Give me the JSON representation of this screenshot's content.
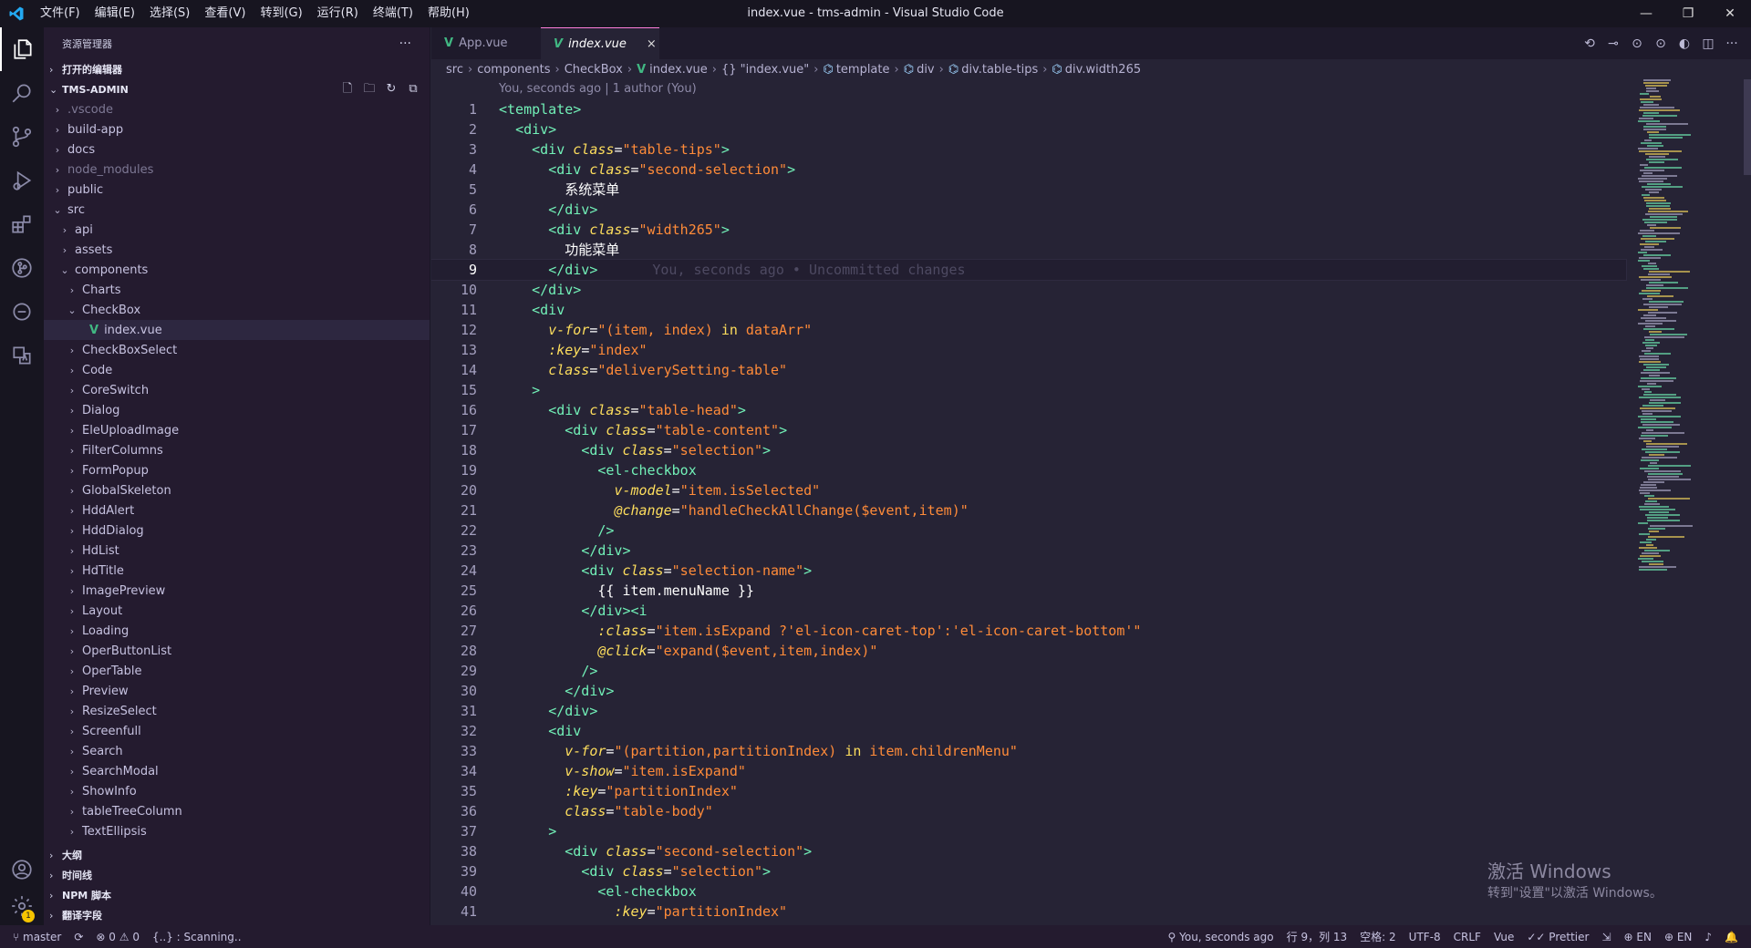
{
  "menu": [
    "文件(F)",
    "编辑(E)",
    "选择(S)",
    "查看(V)",
    "转到(G)",
    "运行(R)",
    "终端(T)",
    "帮助(H)"
  ],
  "window_title": "index.vue - tms-admin - Visual Studio Code",
  "sidebar": {
    "title": "资源管理器",
    "more": "···",
    "open_editors": "打开的编辑器",
    "project": "TMS-ADMIN",
    "tree": [
      {
        "label": ".vscode",
        "indent": 0,
        "chev": "›",
        "dim": true
      },
      {
        "label": "build-app",
        "indent": 0,
        "chev": "›"
      },
      {
        "label": "docs",
        "indent": 0,
        "chev": "›"
      },
      {
        "label": "node_modules",
        "indent": 0,
        "chev": "›",
        "dim": true
      },
      {
        "label": "public",
        "indent": 0,
        "chev": "›"
      },
      {
        "label": "src",
        "indent": 0,
        "chev": "⌄"
      },
      {
        "label": "api",
        "indent": 1,
        "chev": "›"
      },
      {
        "label": "assets",
        "indent": 1,
        "chev": "›"
      },
      {
        "label": "components",
        "indent": 1,
        "chev": "⌄"
      },
      {
        "label": "Charts",
        "indent": 2,
        "chev": "›"
      },
      {
        "label": "CheckBox",
        "indent": 2,
        "chev": "⌄"
      },
      {
        "label": "index.vue",
        "indent": 3,
        "chev": "",
        "vue": true,
        "selected": true
      },
      {
        "label": "CheckBoxSelect",
        "indent": 2,
        "chev": "›"
      },
      {
        "label": "Code",
        "indent": 2,
        "chev": "›"
      },
      {
        "label": "CoreSwitch",
        "indent": 2,
        "chev": "›"
      },
      {
        "label": "Dialog",
        "indent": 2,
        "chev": "›"
      },
      {
        "label": "EleUploadImage",
        "indent": 2,
        "chev": "›"
      },
      {
        "label": "FilterColumns",
        "indent": 2,
        "chev": "›"
      },
      {
        "label": "FormPopup",
        "indent": 2,
        "chev": "›"
      },
      {
        "label": "GlobalSkeleton",
        "indent": 2,
        "chev": "›"
      },
      {
        "label": "HddAlert",
        "indent": 2,
        "chev": "›"
      },
      {
        "label": "HddDialog",
        "indent": 2,
        "chev": "›"
      },
      {
        "label": "HdList",
        "indent": 2,
        "chev": "›"
      },
      {
        "label": "HdTitle",
        "indent": 2,
        "chev": "›"
      },
      {
        "label": "ImagePreview",
        "indent": 2,
        "chev": "›"
      },
      {
        "label": "Layout",
        "indent": 2,
        "chev": "›"
      },
      {
        "label": "Loading",
        "indent": 2,
        "chev": "›"
      },
      {
        "label": "OperButtonList",
        "indent": 2,
        "chev": "›"
      },
      {
        "label": "OperTable",
        "indent": 2,
        "chev": "›"
      },
      {
        "label": "Preview",
        "indent": 2,
        "chev": "›"
      },
      {
        "label": "ResizeSelect",
        "indent": 2,
        "chev": "›"
      },
      {
        "label": "Screenfull",
        "indent": 2,
        "chev": "›"
      },
      {
        "label": "Search",
        "indent": 2,
        "chev": "›"
      },
      {
        "label": "SearchModal",
        "indent": 2,
        "chev": "›"
      },
      {
        "label": "ShowInfo",
        "indent": 2,
        "chev": "›"
      },
      {
        "label": "tableTreeColumn",
        "indent": 2,
        "chev": "›"
      },
      {
        "label": "TextEllipsis",
        "indent": 2,
        "chev": "›"
      }
    ],
    "bottom_sections": [
      "大纲",
      "时间线",
      "NPM 脚本",
      "翻译字段"
    ]
  },
  "tabs": [
    {
      "label": "App.vue",
      "active": false
    },
    {
      "label": "index.vue",
      "active": true,
      "close": "×"
    }
  ],
  "breadcrumb": {
    "src": "src",
    "components": "components",
    "checkbox": "CheckBox",
    "file": "index.vue",
    "obj": "{} \"index.vue\"",
    "template": "template",
    "div": "div",
    "div_table_tips": "div.table-tips",
    "div_width": "div.width265"
  },
  "blame": "You, seconds ago | 1 author (You)",
  "ghost_text": "You, seconds ago • Uncommitted changes",
  "code_lines": [
    {
      "n": "1",
      "html": "<span class='tag'>&lt;template&gt;</span>"
    },
    {
      "n": "2",
      "html": "  <span class='tag'>&lt;div&gt;</span>"
    },
    {
      "n": "3",
      "html": "    <span class='tag'>&lt;div</span> <span class='attr'>class</span>=<span class='str'>\"table-tips\"</span><span class='tag'>&gt;</span>"
    },
    {
      "n": "4",
      "html": "      <span class='tag'>&lt;div</span> <span class='attr'>class</span>=<span class='str'>\"second-selection\"</span><span class='tag'>&gt;</span>"
    },
    {
      "n": "5",
      "html": "        系统菜单"
    },
    {
      "n": "6",
      "html": "      <span class='tag'>&lt;/div&gt;</span>"
    },
    {
      "n": "7",
      "html": "      <span class='tag'>&lt;div</span> <span class='attr'>class</span>=<span class='str'>\"width265\"</span><span class='tag'>&gt;</span>"
    },
    {
      "n": "8",
      "html": "        功能菜单"
    },
    {
      "n": "9",
      "html": "      <span class='tag'>&lt;/div&gt;</span>",
      "cur": true
    },
    {
      "n": "10",
      "html": "    <span class='tag'>&lt;/div&gt;</span>"
    },
    {
      "n": "11",
      "html": "    <span class='tag'>&lt;div</span>"
    },
    {
      "n": "12",
      "html": "      <span class='attr'>v-for</span>=<span class='str'>\"(item, index) <span class='kw'>in</span> dataArr\"</span>"
    },
    {
      "n": "13",
      "html": "      <span class='attr'>:key</span>=<span class='str'>\"index\"</span>"
    },
    {
      "n": "14",
      "html": "      <span class='attr'>class</span>=<span class='str'>\"deliverySetting-table\"</span>"
    },
    {
      "n": "15",
      "html": "    <span class='tag'>&gt;</span>"
    },
    {
      "n": "16",
      "html": "      <span class='tag'>&lt;div</span> <span class='attr'>class</span>=<span class='str'>\"table-head\"</span><span class='tag'>&gt;</span>"
    },
    {
      "n": "17",
      "html": "        <span class='tag'>&lt;div</span> <span class='attr'>class</span>=<span class='str'>\"table-content\"</span><span class='tag'>&gt;</span>"
    },
    {
      "n": "18",
      "html": "          <span class='tag'>&lt;div</span> <span class='attr'>class</span>=<span class='str'>\"selection\"</span><span class='tag'>&gt;</span>"
    },
    {
      "n": "19",
      "html": "            <span class='tag'>&lt;el-checkbox</span>"
    },
    {
      "n": "20",
      "html": "              <span class='attr'>v-model</span>=<span class='str'>\"item.isSelected\"</span>"
    },
    {
      "n": "21",
      "html": "              <span class='attr'>@change</span>=<span class='str'>\"handleCheckAllChange($event,item)\"</span>"
    },
    {
      "n": "22",
      "html": "            <span class='tag'>/&gt;</span>"
    },
    {
      "n": "23",
      "html": "          <span class='tag'>&lt;/div&gt;</span>"
    },
    {
      "n": "24",
      "html": "          <span class='tag'>&lt;div</span> <span class='attr'>class</span>=<span class='str'>\"selection-name\"</span><span class='tag'>&gt;</span>"
    },
    {
      "n": "25",
      "html": "            {{ item.menuName }}"
    },
    {
      "n": "26",
      "html": "          <span class='tag'>&lt;/div&gt;&lt;i</span>"
    },
    {
      "n": "27",
      "html": "            <span class='attr'>:class</span>=<span class='str'>\"item.isExpand ?'el-icon-caret-top':'el-icon-caret-bottom'\"</span>"
    },
    {
      "n": "28",
      "html": "            <span class='attr'>@click</span>=<span class='str'>\"expand($event,item,index)\"</span>"
    },
    {
      "n": "29",
      "html": "          <span class='tag'>/&gt;</span>"
    },
    {
      "n": "30",
      "html": "        <span class='tag'>&lt;/div&gt;</span>"
    },
    {
      "n": "31",
      "html": "      <span class='tag'>&lt;/div&gt;</span>"
    },
    {
      "n": "32",
      "html": "      <span class='tag'>&lt;div</span>"
    },
    {
      "n": "33",
      "html": "        <span class='attr'>v-for</span>=<span class='str'>\"(partition,partitionIndex) <span class='kw'>in</span> item.childrenMenu\"</span>"
    },
    {
      "n": "34",
      "html": "        <span class='attr'>v-show</span>=<span class='str'>\"item.isExpand\"</span>"
    },
    {
      "n": "35",
      "html": "        <span class='attr'>:key</span>=<span class='str'>\"partitionIndex\"</span>"
    },
    {
      "n": "36",
      "html": "        <span class='attr'>class</span>=<span class='str'>\"table-body\"</span>"
    },
    {
      "n": "37",
      "html": "      <span class='tag'>&gt;</span>"
    },
    {
      "n": "38",
      "html": "        <span class='tag'>&lt;div</span> <span class='attr'>class</span>=<span class='str'>\"second-selection\"</span><span class='tag'>&gt;</span>"
    },
    {
      "n": "39",
      "html": "          <span class='tag'>&lt;div</span> <span class='attr'>class</span>=<span class='str'>\"selection\"</span><span class='tag'>&gt;</span>"
    },
    {
      "n": "40",
      "html": "            <span class='tag'>&lt;el-checkbox</span>"
    },
    {
      "n": "41",
      "html": "              <span class='attr'>:key</span>=<span class='str'>\"partitionIndex\"</span>"
    }
  ],
  "watermark": {
    "line1": "激活 Windows",
    "line2": "转到\"设置\"以激活 Windows。"
  },
  "statusbar": {
    "branch": "master",
    "errors": "0",
    "warnings": "0",
    "scanning": "{..} : Scanning..",
    "blame": "You, seconds ago",
    "position": "行 9，列 13",
    "spaces": "空格: 2",
    "encoding": "UTF-8",
    "eol": "CRLF",
    "language": "Vue",
    "prettier": "Prettier",
    "lang1": "EN",
    "lang2": "EN"
  }
}
